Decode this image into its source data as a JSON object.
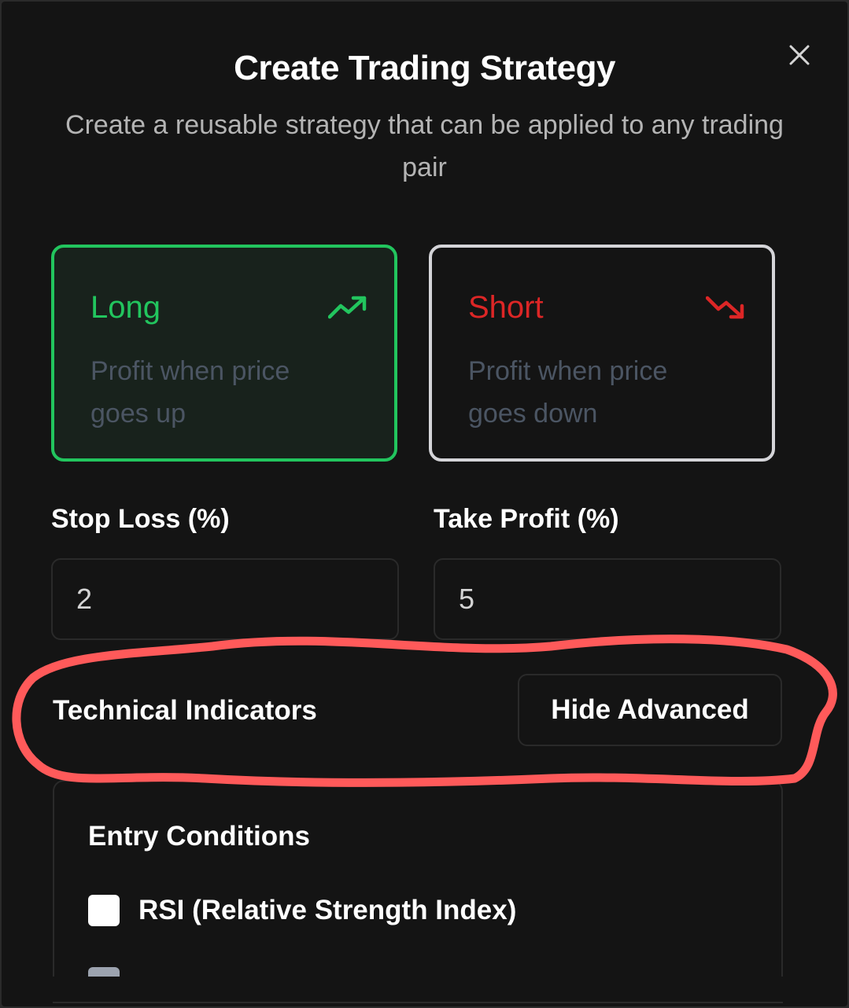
{
  "dialog": {
    "title": "Create Trading Strategy",
    "subtitle": "Create a reusable strategy that can be applied to any trading pair",
    "close_icon": "close-icon"
  },
  "direction": {
    "long": {
      "title": "Long",
      "description": "Profit when price goes up",
      "icon": "trending-up-icon",
      "color": "#22c55e",
      "selected": true
    },
    "short": {
      "title": "Short",
      "description": "Profit when price goes down",
      "icon": "trending-down-icon",
      "color": "#dc2626",
      "selected": false
    }
  },
  "risk": {
    "stop_loss_label": "Stop Loss (%)",
    "stop_loss_value": "2",
    "take_profit_label": "Take Profit (%)",
    "take_profit_value": "5"
  },
  "indicators": {
    "heading": "Technical Indicators",
    "toggle_label": "Hide Advanced",
    "entry_heading": "Entry Conditions",
    "items": [
      {
        "label": "RSI (Relative Strength Index)",
        "checked": false
      }
    ]
  },
  "annotation_color": "#ff5a5a"
}
